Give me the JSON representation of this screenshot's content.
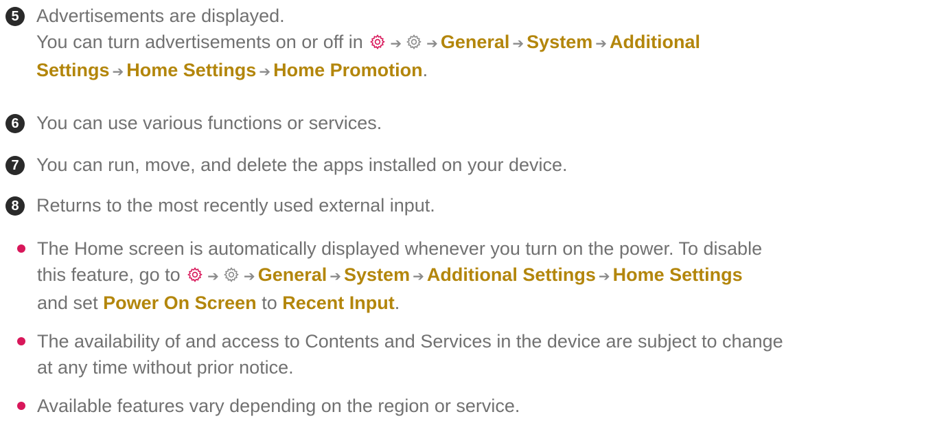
{
  "item5": {
    "marker": "5",
    "line1": "Advertisements are displayed.",
    "prefix": "You can turn advertisements on or off in",
    "path": [
      "General",
      "System",
      "Additional",
      "Settings",
      "Home Settings",
      "Home Promotion"
    ],
    "suffix": "."
  },
  "item6": {
    "marker": "6",
    "text": "You can use various functions or services."
  },
  "item7": {
    "marker": "7",
    "text": "You can run, move, and delete the apps installed on your device."
  },
  "item8": {
    "marker": "8",
    "text": "Returns to the most recently used external input."
  },
  "bullet1": {
    "line1": "The Home screen is automatically displayed whenever you turn on the power. To disable",
    "prefix": "this feature, go to",
    "path": [
      "General",
      "System",
      "Additional Settings",
      "Home Settings"
    ],
    "line3_pre": "and set",
    "setting": "Power On Screen",
    "line3_mid": "to",
    "value": "Recent Input",
    "line3_end": "."
  },
  "bullet2": {
    "line1": "The availability of and access to Contents and Services in the device are subject to change",
    "line2": "at any time without prior notice."
  },
  "bullet3": {
    "text": "Available features vary depending on the region or service."
  },
  "icons": {
    "quick_settings": "gear-icon",
    "all_settings": "gear-outline-icon",
    "arrow": "arrow-right-icon"
  },
  "colors": {
    "text": "#717171",
    "keyword": "#b3860c",
    "bullet": "#d8175a",
    "marker": "#2a2a2a",
    "red_gear": "#d8175a",
    "gray_gear": "#8b8b8b"
  }
}
